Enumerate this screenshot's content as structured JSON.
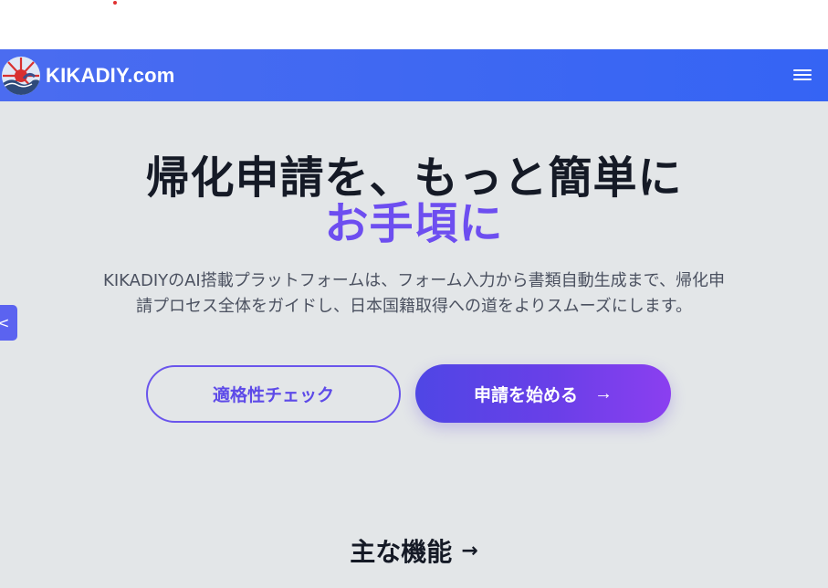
{
  "header": {
    "site_name": "KIKADIY.com",
    "logo_icon": "logo-wave-icon",
    "menu_icon": "hamburger-menu-icon"
  },
  "hero": {
    "headline_line1": "帰化申請を、もっと簡単に",
    "headline_line2": "お手頃に",
    "subtitle_line1": "KIKADIYのAI搭載プラットフォームは、フォーム入力から書類自動生成まで、帰化申",
    "subtitle_line2": "請プロセス全体をガイドし、日本国籍取得への道をよりスムーズにします。",
    "side_tab_glyph": "<",
    "buttons": {
      "eligibility_label": "適格性チェック",
      "start_label": "申請を始める",
      "start_arrow": "→"
    }
  },
  "features": {
    "title": "主な機能",
    "arrow": "→"
  },
  "colors": {
    "brand_blue": "#3f68f2",
    "accent_purple": "#6d4ef0",
    "hero_bg": "#e3e6e8",
    "text_dark": "#151a26"
  }
}
